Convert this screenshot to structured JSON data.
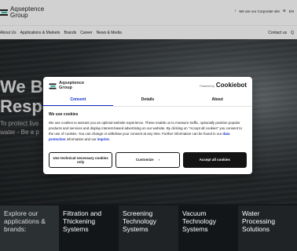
{
  "brand": {
    "line1": "Aqseptence",
    "line2": "Group"
  },
  "topbar": {
    "corporate_link": "We are our Corporate site",
    "lang": "EN"
  },
  "nav": {
    "items": [
      "About Us",
      "Applications & Markets",
      "Brands",
      "Career",
      "News & Media"
    ],
    "right": [
      "Contact us",
      "Q"
    ]
  },
  "hero": {
    "title_line1": "We B",
    "title_line2": "Respo",
    "sub_line1": "To protect live",
    "sub_line2": "water - Be a p"
  },
  "tiles": {
    "intro": "Explore our applications & brands:",
    "items": [
      "Filtration and Thickening Systems",
      "Screening Technology Systems",
      "Vacuum Technology Systems",
      "Water Processing Solutions"
    ]
  },
  "cookie": {
    "brand_line1": "Aqseptence",
    "brand_line2": "Group",
    "powered_by": "Powered by",
    "cookiebot": "Cookiebot",
    "tabs": [
      "Consent",
      "Details",
      "About"
    ],
    "heading": "We use cookies",
    "text": "We use cookies to warrant you an optimal website experience. These enable us to measure traffic, optionally position popular products and services and display interest-based advertising on our website. By clicking on \"Accept all cookies\" you consent to the use of cookies. You can change or withdraw your consent at any time. Further information can be found in our",
    "link": "data protection",
    "text_after": "information and our",
    "link2": "imprint.",
    "buttons": {
      "necessary": "Use technical necessary cookies only",
      "customize": "Customize",
      "accept": "Accept all cookies"
    }
  },
  "colors": {
    "accent": "#29b9a7",
    "link": "#1032cf",
    "dark": "#141414"
  }
}
